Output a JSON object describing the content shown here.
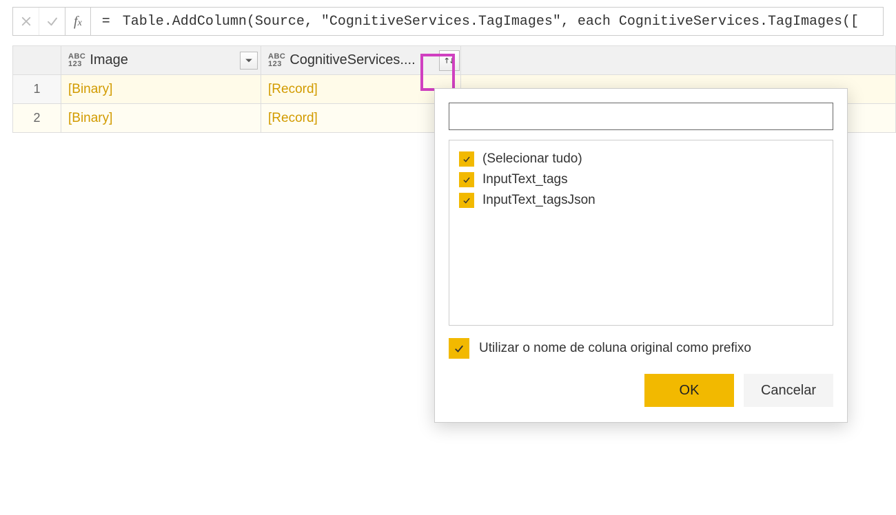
{
  "formula_bar": {
    "equals": "=",
    "formula": "Table.AddColumn(Source, \"CognitiveServices.TagImages\", each CognitiveServices.TagImages(["
  },
  "columns": {
    "image": {
      "label": "Image"
    },
    "cog": {
      "label": "CognitiveServices...."
    }
  },
  "rows": [
    {
      "num": "1",
      "image": "[Binary]",
      "cog": "[Record]"
    },
    {
      "num": "2",
      "image": "[Binary]",
      "cog": "[Record]"
    }
  ],
  "popup": {
    "search_placeholder": "",
    "items": [
      {
        "label": "(Selecionar tudo)",
        "checked": true
      },
      {
        "label": "InputText_tags",
        "checked": true
      },
      {
        "label": "InputText_tagsJson",
        "checked": true
      }
    ],
    "prefix_label": "Utilizar o nome de coluna original como prefixo",
    "prefix_checked": true,
    "ok_label": "OK",
    "cancel_label": "Cancelar"
  },
  "colors": {
    "accent": "#f2b900",
    "highlight": "#d040c0",
    "link": "#d29b00"
  }
}
